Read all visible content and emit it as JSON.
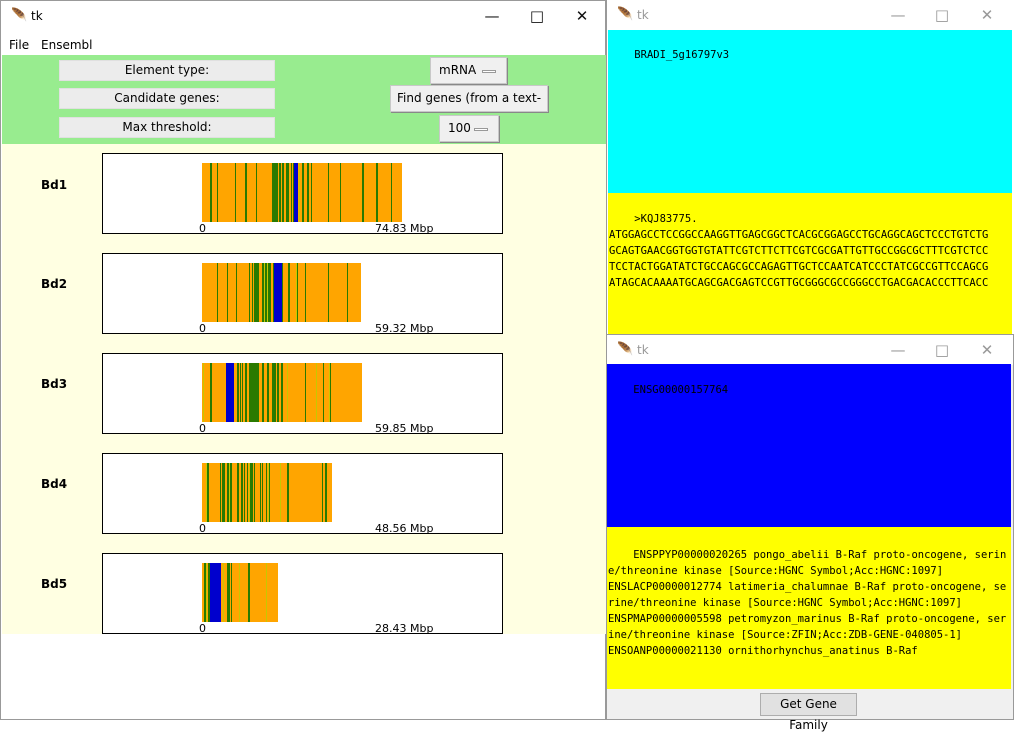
{
  "main_window": {
    "title": "tk",
    "menu": [
      "File",
      "Ensembl"
    ],
    "controls": {
      "element_type_label": "Element type:",
      "candidate_genes_label": "Candidate genes:",
      "max_threshold_label": "Max threshold:",
      "element_type_value": "mRNA",
      "find_genes_button": "Find genes (from a text-file)",
      "max_threshold_value": "100"
    },
    "chromosomes": [
      {
        "name": "Bd1",
        "start": "0",
        "length_label": "74.83 Mbp",
        "length_mbp": 74.83
      },
      {
        "name": "Bd2",
        "start": "0",
        "length_label": "59.32 Mbp",
        "length_mbp": 59.32
      },
      {
        "name": "Bd3",
        "start": "0",
        "length_label": "59.85 Mbp",
        "length_mbp": 59.85
      },
      {
        "name": "Bd4",
        "start": "0",
        "length_label": "48.56 Mbp",
        "length_mbp": 48.56
      },
      {
        "name": "Bd5",
        "start": "0",
        "length_label": "28.43 Mbp",
        "length_mbp": 28.43
      }
    ],
    "colors": {
      "bar": "#ffa500",
      "green_mark": "#2a7a00",
      "blue_mark": "#0000cd",
      "control_bg": "#98ec8f",
      "pane_bg": "#ffffe2"
    }
  },
  "window_right_top": {
    "title": "tk",
    "gene_id": "BRADI_5g16797v3",
    "sequence": ">KQJ83775.\nATGGAGCCTCCGGCCAAGGTTGAGCGGCTCACGCGGAGCCTGCAGGCAGCTCCCTGTCTG\nGCAGTGAACGGTGGTGTATTCGTCTTCTTCGTCGCGATTGTTGCCGGCGCTTTCGTCTCC\nTCCTACTGGATATCTGCCAGCGCCAGAGTTGCTCCAATCATCCCTATCGCCGTTCCAGCG\nATAGCACAAAATGCAGCGACGAGTCCGTTGCGGGCGCCGGGCCTGACGACACCCTTCACC",
    "colors": {
      "top": "#00ffff",
      "bottom": "#ffff00"
    }
  },
  "window_right_bottom": {
    "title": "tk",
    "gene_id": "ENSG00000157764",
    "family_text": "ENSPPYP00000020265 pongo_abelii B-Raf proto-oncogene, serine/threonine kinase [Source:HGNC Symbol;Acc:HGNC:1097]\nENSLACP00000012774 latimeria_chalumnae B-Raf proto-oncogene, serine/threonine kinase [Source:HGNC Symbol;Acc:HGNC:1097]\nENSPMAP00000005598 petromyzon_marinus B-Raf proto-oncogene, serine/threonine kinase [Source:ZFIN;Acc:ZDB-GENE-040805-1]\nENSOANP00000021130 ornithorhynchus_anatinus B-Raf",
    "button": "Get Gene Family",
    "colors": {
      "top": "#0000ff",
      "bottom": "#ffff00"
    }
  }
}
